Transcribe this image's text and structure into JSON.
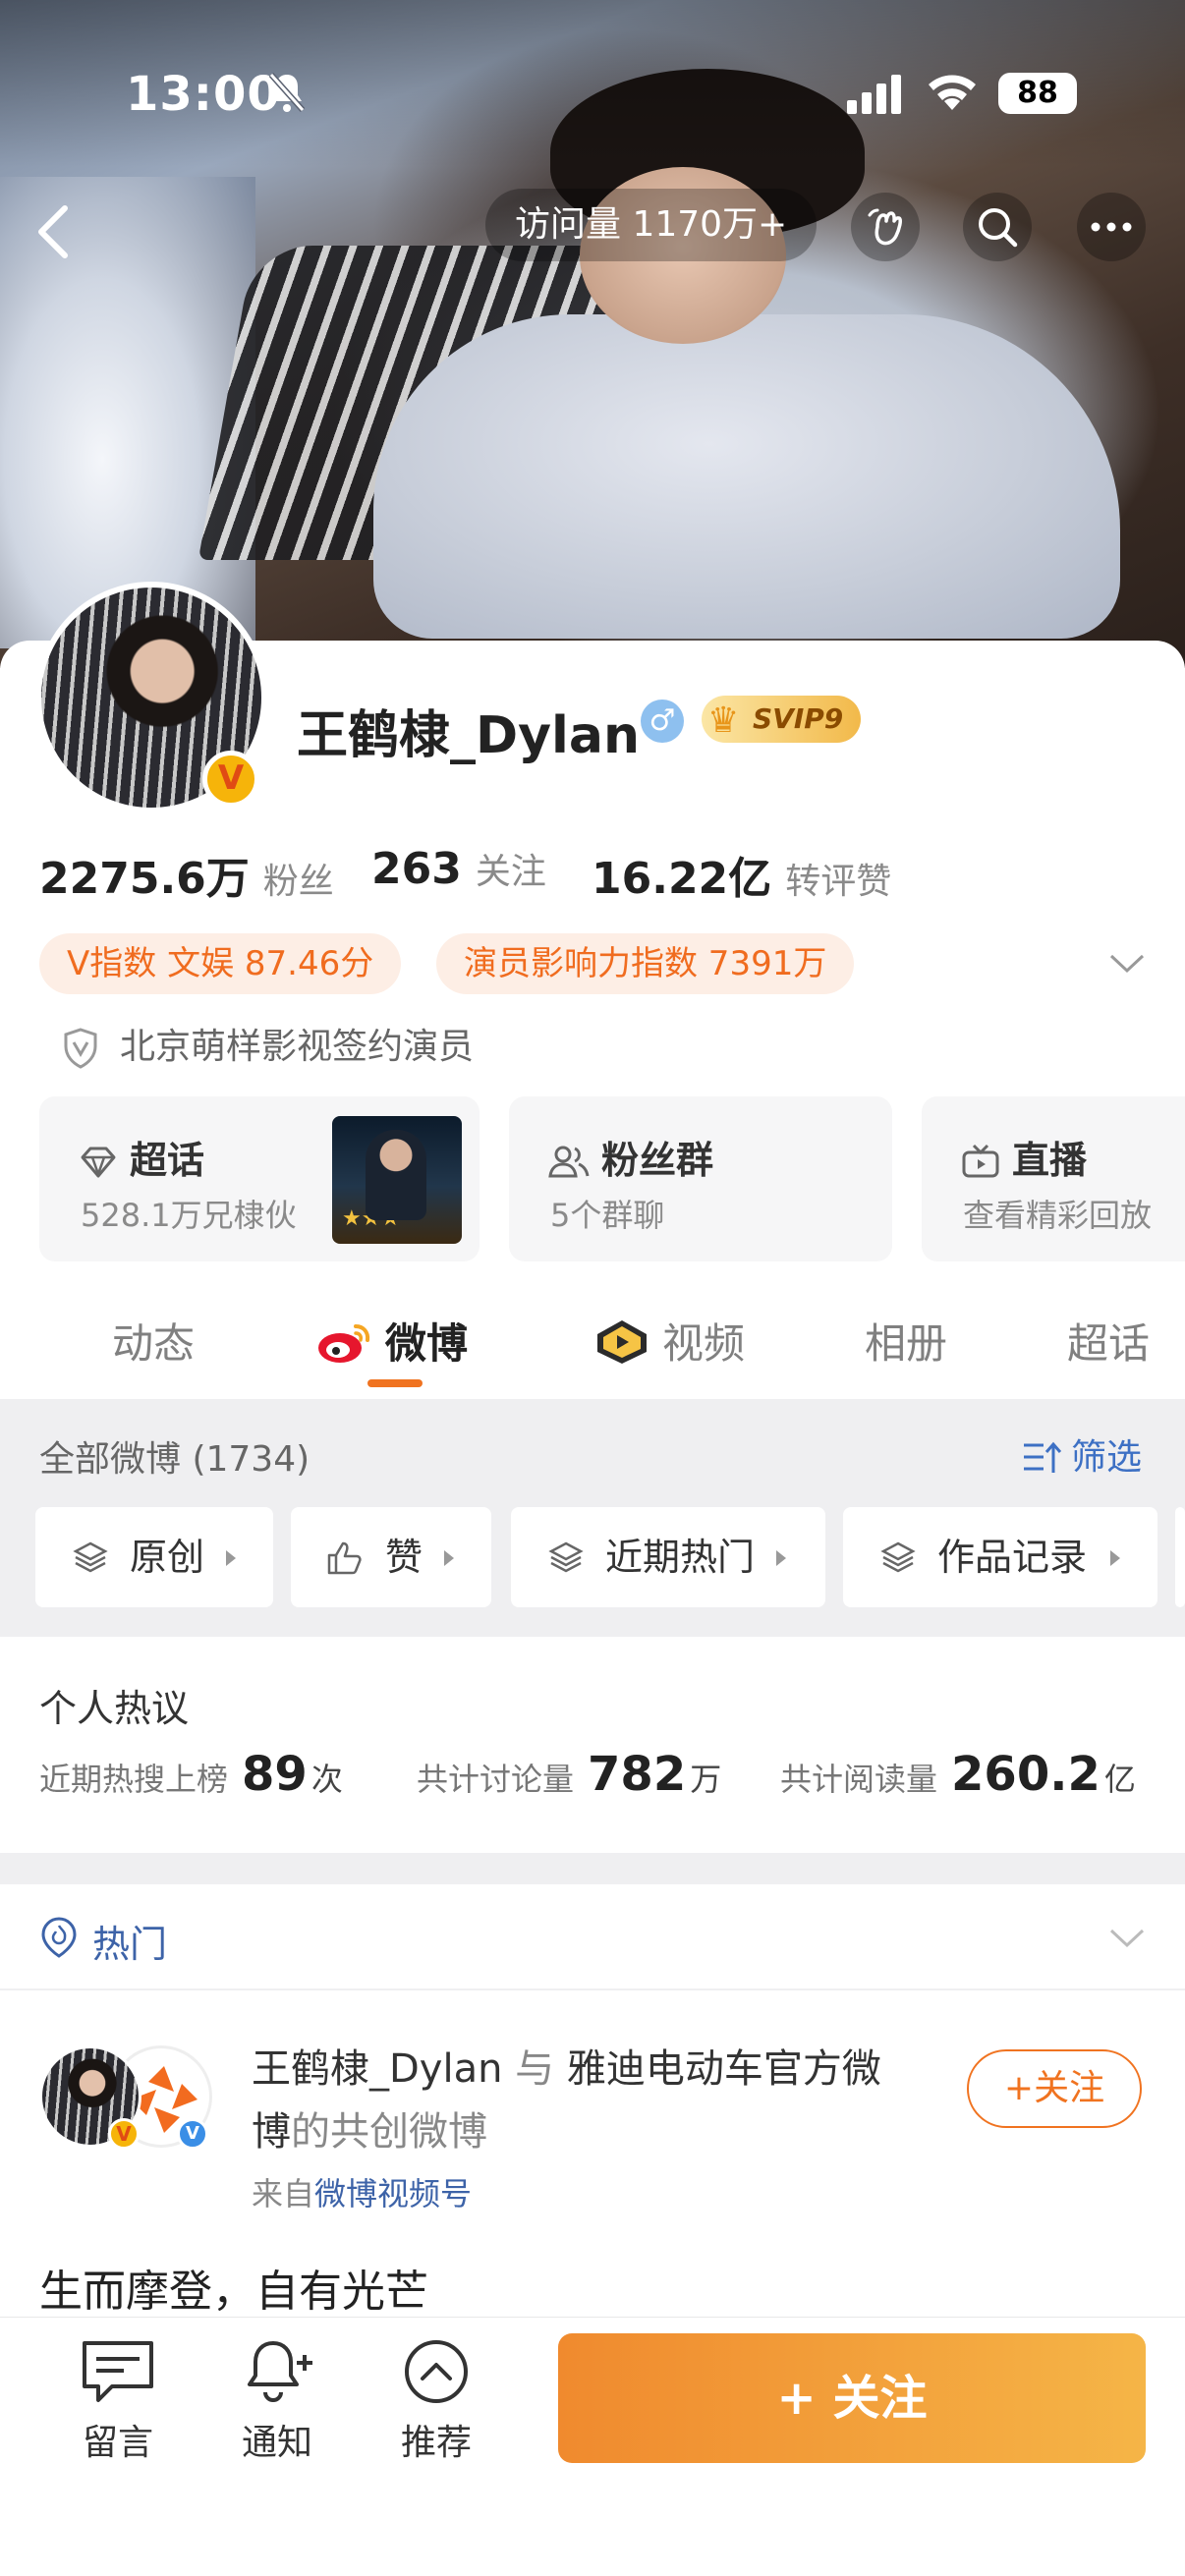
{
  "status_bar": {
    "time": "13:00",
    "battery": "88"
  },
  "header": {
    "visits": "访问量 1170万+"
  },
  "profile": {
    "name": "王鹤棣_Dylan",
    "gender_symbol": "♂",
    "svip": "SVIP9",
    "verified_badge": "V",
    "stats": [
      {
        "value": "2275.6万",
        "label": "粉丝"
      },
      {
        "value": "263",
        "label": "关注"
      },
      {
        "value": "16.22亿",
        "label": "转评赞"
      }
    ],
    "tags": [
      "V指数 文娱 87.46分",
      "演员影响力指数 7391万"
    ],
    "organization": "北京萌样影视签约演员"
  },
  "tiles": [
    {
      "title": "超话",
      "subtitle": "528.1万兄棣伙",
      "icon": "diamond-icon"
    },
    {
      "title": "粉丝群",
      "subtitle": "5个群聊",
      "icon": "group-icon"
    },
    {
      "title": "直播",
      "subtitle": "查看精彩回放",
      "icon": "tv-icon"
    }
  ],
  "tabs": [
    "动态",
    "微博",
    "视频",
    "相册",
    "超话"
  ],
  "active_tab": "微博",
  "weibo_filter": {
    "count_label": "全部微博 (1734)",
    "screen_label": "筛选",
    "chips": [
      "原创",
      "赞",
      "近期热门",
      "作品记录"
    ]
  },
  "heat": {
    "title": "个人热议",
    "items": [
      {
        "label": "近期热搜上榜",
        "value": "89",
        "unit": "次"
      },
      {
        "label": "共计讨论量",
        "value": "782",
        "unit": "万"
      },
      {
        "label": "共计阅读量",
        "value": "260.2",
        "unit": "亿"
      }
    ]
  },
  "hot_label": "热门",
  "post": {
    "author": "王鹤棣_Dylan",
    "joiner": " 与 ",
    "partner_line1": "雅迪电动车官方微",
    "partner_line2": "博",
    "suffix": "的共创微博",
    "source_prefix": "来自",
    "source_link": "微博视频号",
    "follow_label": "+关注",
    "content": "生而摩登，自有光芒"
  },
  "bottom": {
    "message": "留言",
    "notify": "通知",
    "recommend": "推荐",
    "follow": "+ 关注"
  },
  "colors": {
    "accent": "#f07320",
    "link": "#3d63a8"
  }
}
